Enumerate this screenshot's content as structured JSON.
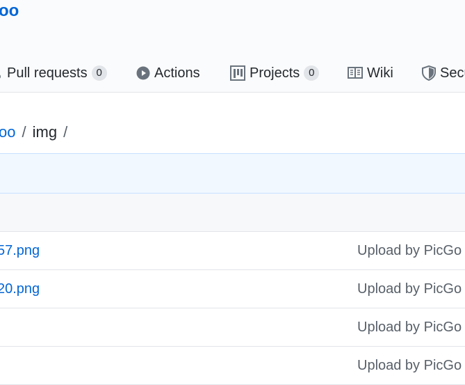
{
  "repo": {
    "name": "oo"
  },
  "tabs": [
    {
      "label": "Pull requests",
      "count": "0",
      "icon": "pull-request-icon"
    },
    {
      "label": "Actions",
      "icon": "play-icon"
    },
    {
      "label": "Projects",
      "count": "0",
      "icon": "project-icon"
    },
    {
      "label": "Wiki",
      "icon": "book-icon"
    },
    {
      "label": "Secu",
      "icon": "shield-icon"
    }
  ],
  "breadcrumb": {
    "parent": "oo",
    "separator": "/",
    "current": "img"
  },
  "files": [
    {
      "name": "57.png",
      "message": "Upload by PicGo"
    },
    {
      "name": "20.png",
      "message": "Upload by PicGo"
    },
    {
      "name": "",
      "message": "Upload by PicGo"
    },
    {
      "name": "",
      "message": "Upload by PicGo"
    }
  ],
  "colors": {
    "link": "#0366d6",
    "header_bg": "#fafbfc",
    "commit_bar_bg": "#f1f8ff",
    "border": "#e1e4e8"
  }
}
